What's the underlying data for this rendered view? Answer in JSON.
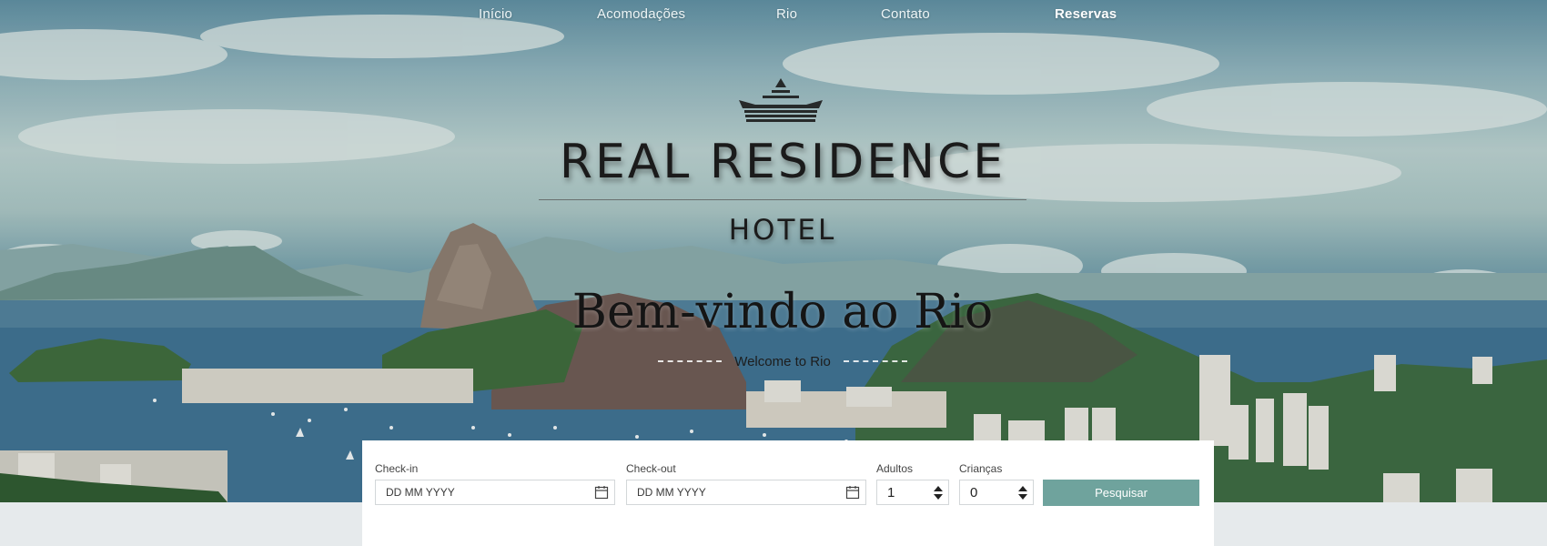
{
  "nav": {
    "items": [
      {
        "label": "Início"
      },
      {
        "label": "Acomodações"
      },
      {
        "label": "Rio"
      },
      {
        "label": "Contato"
      },
      {
        "label": "Reservas"
      }
    ]
  },
  "logo": {
    "title": "REAL RESIDENCE",
    "subtitle": "HOTEL",
    "icon": "crown-icon"
  },
  "hero": {
    "heading": "Bem-vindo ao Rio",
    "subheading": "Welcome to Rio"
  },
  "booking": {
    "checkin": {
      "label": "Check-in",
      "placeholder": "DD MM YYYY",
      "icon": "calendar-icon"
    },
    "checkout": {
      "label": "Check-out",
      "placeholder": "DD MM YYYY",
      "icon": "calendar-icon"
    },
    "adults": {
      "label": "Adultos",
      "value": "1"
    },
    "children": {
      "label": "Crianças",
      "value": "0"
    },
    "search_label": "Pesquisar"
  },
  "colors": {
    "accent": "#6fa39d",
    "page_bg": "#e6eaec"
  }
}
